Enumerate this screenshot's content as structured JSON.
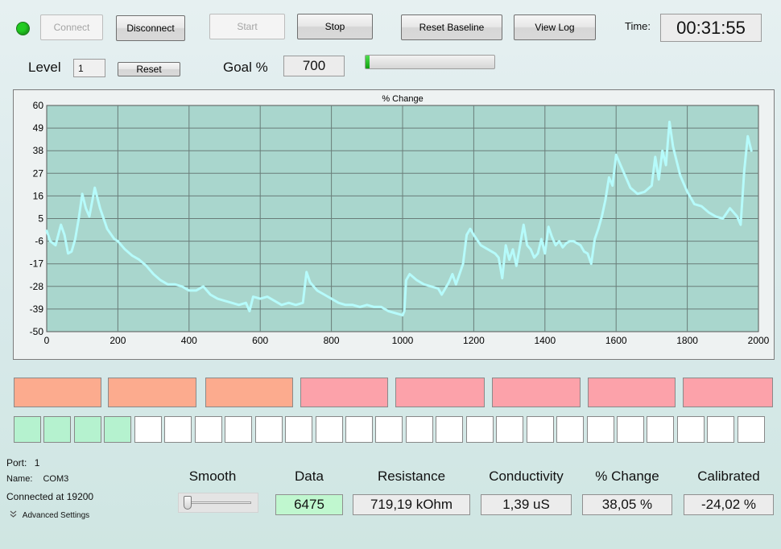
{
  "toolbar": {
    "connect_label": "Connect",
    "disconnect_label": "Disconnect",
    "start_label": "Start",
    "stop_label": "Stop",
    "reset_baseline_label": "Reset Baseline",
    "view_log_label": "View Log",
    "time_label": "Time:",
    "time_value": "00:31:55",
    "status_color": "#22cc22"
  },
  "level": {
    "label": "Level",
    "value": "1",
    "reset_label": "Reset"
  },
  "goal": {
    "label": "Goal %",
    "value": "700",
    "progress": 0.03
  },
  "chart_data": {
    "type": "line",
    "title": "% Change",
    "xlim": [
      0,
      2000
    ],
    "ylim": [
      -50,
      60
    ],
    "x_ticks": [
      "0",
      "200",
      "400",
      "600",
      "800",
      "1000",
      "1200",
      "1400",
      "1600",
      "1800",
      "2000"
    ],
    "y_ticks": [
      "60",
      "49",
      "38",
      "27",
      "16",
      "5",
      "-6",
      "-17",
      "-28",
      "-39",
      "-50"
    ],
    "grid": true,
    "background_color": "#a9d6cd",
    "line_color": "#b6fbfb",
    "series": [
      {
        "x": [
          0,
          10,
          25,
          40,
          50,
          60,
          70,
          80,
          90,
          100,
          110,
          120,
          135,
          150,
          170,
          190,
          200,
          220,
          240,
          260,
          280,
          300,
          320,
          340,
          350,
          360,
          380,
          400,
          420,
          440,
          460,
          480,
          500,
          520,
          540,
          560,
          570,
          580,
          600,
          620,
          640,
          660,
          680,
          700,
          720,
          730,
          740,
          760,
          780,
          800,
          820,
          840,
          860,
          880,
          900,
          920,
          940,
          960,
          980,
          1000,
          1005,
          1010,
          1020,
          1040,
          1060,
          1080,
          1100,
          1110,
          1130,
          1140,
          1150,
          1160,
          1170,
          1180,
          1190,
          1200,
          1220,
          1240,
          1260,
          1270,
          1280,
          1290,
          1300,
          1310,
          1320,
          1330,
          1340,
          1350,
          1360,
          1370,
          1380,
          1390,
          1400,
          1410,
          1420,
          1430,
          1440,
          1450,
          1460,
          1470,
          1480,
          1490,
          1500,
          1510,
          1520,
          1530,
          1540,
          1550,
          1560,
          1570,
          1580,
          1590,
          1600,
          1620,
          1640,
          1660,
          1680,
          1700,
          1710,
          1720,
          1730,
          1740,
          1750,
          1760,
          1780,
          1800,
          1820,
          1840,
          1860,
          1880,
          1900,
          1920,
          1940,
          1950,
          1960,
          1970,
          1980
        ],
        "y": [
          -1,
          -6,
          -8,
          2,
          -3,
          -12,
          -11,
          -5,
          5,
          17,
          10,
          6,
          20,
          10,
          0,
          -5,
          -6,
          -10,
          -13,
          -15,
          -18,
          -22,
          -25,
          -27,
          -27,
          -27,
          -28,
          -30,
          -30,
          -28,
          -32,
          -34,
          -35,
          -36,
          -37,
          -36,
          -40,
          -33,
          -34,
          -33,
          -35,
          -37,
          -36,
          -37,
          -36,
          -21,
          -26,
          -30,
          -32,
          -34,
          -36,
          -37,
          -37,
          -38,
          -37,
          -38,
          -38,
          -40,
          -41,
          -42,
          -40,
          -25,
          -22,
          -25,
          -27,
          -28,
          -29,
          -32,
          -26,
          -22,
          -27,
          -22,
          -17,
          -3,
          0,
          -3,
          -8,
          -10,
          -12,
          -14,
          -24,
          -8,
          -15,
          -10,
          -18,
          -8,
          2,
          -8,
          -10,
          -14,
          -12,
          -5,
          -12,
          1,
          -4,
          -8,
          -6,
          -9,
          -7,
          -6,
          -6,
          -7,
          -8,
          -11,
          -12,
          -17,
          -5,
          0,
          6,
          14,
          25,
          21,
          36,
          28,
          20,
          17,
          18,
          21,
          35,
          24,
          38,
          31,
          52,
          40,
          26,
          18,
          12,
          11,
          8,
          6,
          5,
          10,
          6,
          2,
          28,
          45,
          38
        ]
      }
    ]
  },
  "segments": [
    {
      "color": "#fcab8e"
    },
    {
      "color": "#fcab8e"
    },
    {
      "color": "#fcab8e"
    },
    {
      "color": "#fca2aa"
    },
    {
      "color": "#fca2aa"
    },
    {
      "color": "#fca2aa"
    },
    {
      "color": "#fca2aa"
    },
    {
      "color": "#fca2aa"
    }
  ],
  "level_squares": {
    "active_count": 4,
    "total": 25
  },
  "port_info": {
    "port_label": "Port:",
    "port_value": "1",
    "name_label": "Name:",
    "name_value": "COM3",
    "connected_text": "Connected at 19200",
    "advanced_label": "Advanced Settings"
  },
  "smooth": {
    "label": "Smooth",
    "value": 0
  },
  "readouts": [
    {
      "label": "Data",
      "value": "6475",
      "highlight": "#c0f7cf"
    },
    {
      "label": "Resistance",
      "value": "719,19 kOhm"
    },
    {
      "label": "Conductivity",
      "value": "1,39 uS"
    },
    {
      "label": "% Change",
      "value": "38,05 %"
    },
    {
      "label": "Calibrated",
      "value": "-24,02 %"
    }
  ]
}
